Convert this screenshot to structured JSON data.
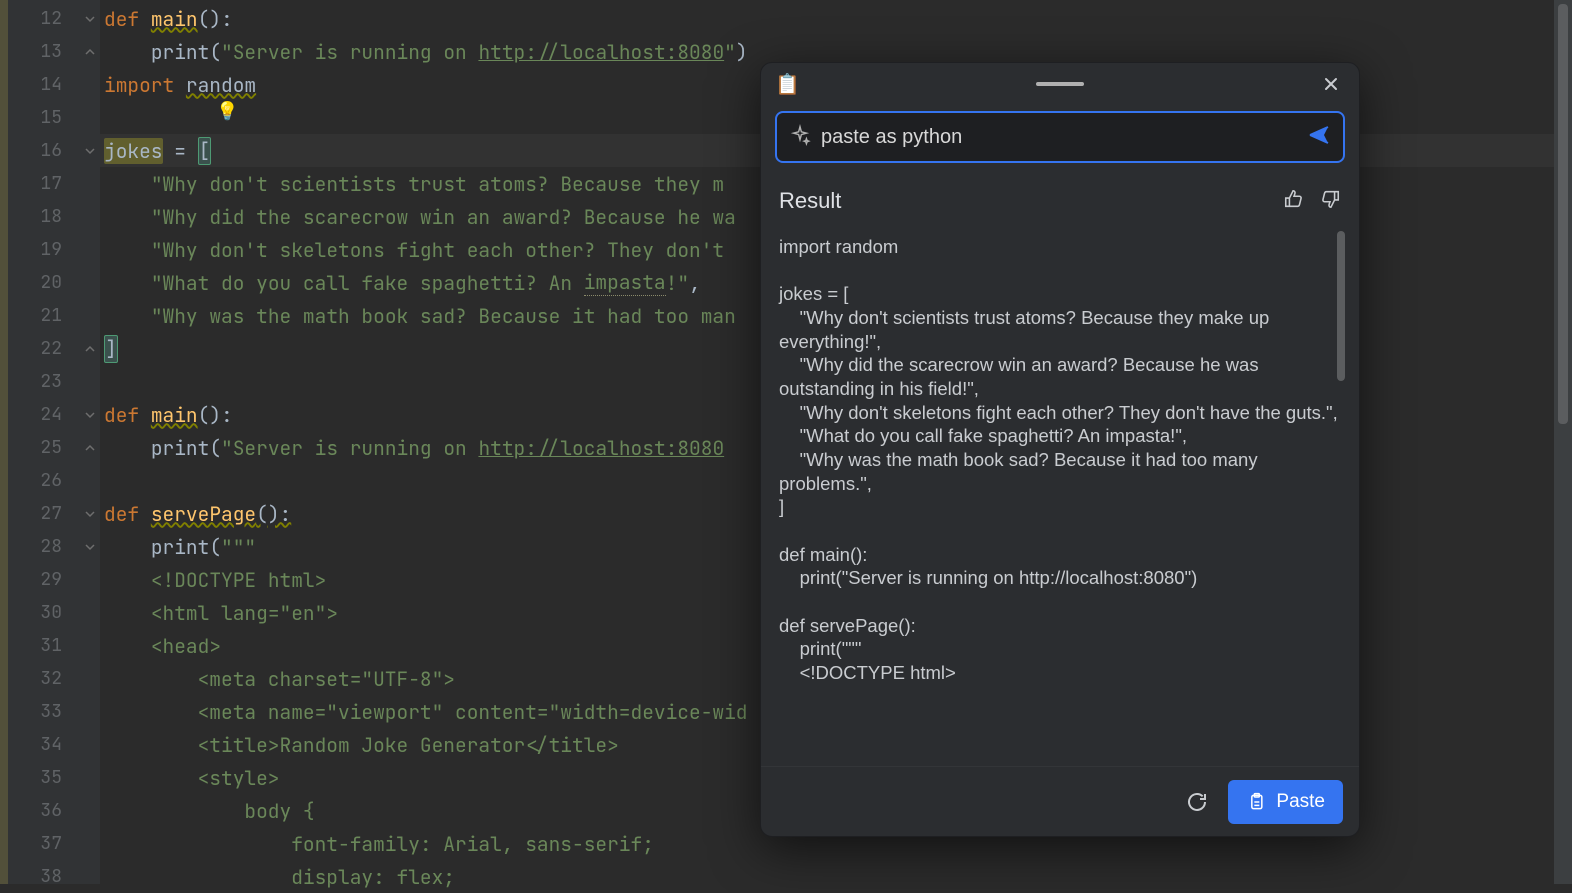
{
  "gutter": {
    "start": 12,
    "end": 38
  },
  "code": {
    "lines": [
      {
        "n": 12,
        "segments": [
          {
            "t": "def ",
            "c": "kw"
          },
          {
            "t": "main",
            "c": "fn warn-underline"
          },
          {
            "t": "():",
            "c": "plain"
          }
        ]
      },
      {
        "n": 13,
        "segments": [
          {
            "t": "    ",
            "c": "plain"
          },
          {
            "t": "print",
            "c": "plain"
          },
          {
            "t": "(",
            "c": "plain"
          },
          {
            "t": "\"Server is running on ",
            "c": "str"
          },
          {
            "t": "http://localhost:8080",
            "c": "url-in-str"
          },
          {
            "t": "\"",
            "c": "str"
          },
          {
            "t": ")",
            "c": "plain"
          }
        ]
      },
      {
        "n": 14,
        "segments": [
          {
            "t": "import ",
            "c": "kw"
          },
          {
            "t": "random",
            "c": "plain warn-underline"
          }
        ]
      },
      {
        "n": 15,
        "segments": []
      },
      {
        "n": 16,
        "segments": [
          {
            "t": "jokes",
            "c": "highlight-var"
          },
          {
            "t": " = ",
            "c": "plain"
          },
          {
            "t": "[",
            "c": "plain bracket-match"
          }
        ],
        "current": true
      },
      {
        "n": 17,
        "segments": [
          {
            "t": "    ",
            "c": "plain"
          },
          {
            "t": "\"Why don't scientists trust atoms? Because they m",
            "c": "str"
          }
        ]
      },
      {
        "n": 18,
        "segments": [
          {
            "t": "    ",
            "c": "plain"
          },
          {
            "t": "\"Why did the scarecrow win an award? Because he wa",
            "c": "str"
          }
        ]
      },
      {
        "n": 19,
        "segments": [
          {
            "t": "    ",
            "c": "plain"
          },
          {
            "t": "\"Why don't skeletons fight each other? They don't",
            "c": "str"
          }
        ]
      },
      {
        "n": 20,
        "segments": [
          {
            "t": "    ",
            "c": "plain"
          },
          {
            "t": "\"What do you call fake spaghetti? An ",
            "c": "str"
          },
          {
            "t": "impasta",
            "c": "str misspell"
          },
          {
            "t": "!\"",
            "c": "str"
          },
          {
            "t": ",",
            "c": "plain"
          }
        ]
      },
      {
        "n": 21,
        "segments": [
          {
            "t": "    ",
            "c": "plain"
          },
          {
            "t": "\"Why was the math book sad? Because it had too man",
            "c": "str"
          }
        ]
      },
      {
        "n": 22,
        "segments": [
          {
            "t": "]",
            "c": "plain bracket-match"
          }
        ]
      },
      {
        "n": 23,
        "segments": []
      },
      {
        "n": 24,
        "segments": [
          {
            "t": "def ",
            "c": "kw"
          },
          {
            "t": "main",
            "c": "fn warn-underline"
          },
          {
            "t": "():",
            "c": "plain"
          }
        ]
      },
      {
        "n": 25,
        "segments": [
          {
            "t": "    ",
            "c": "plain"
          },
          {
            "t": "print",
            "c": "plain"
          },
          {
            "t": "(",
            "c": "plain"
          },
          {
            "t": "\"Server is running on ",
            "c": "str"
          },
          {
            "t": "http://localhost:8080",
            "c": "url-in-str"
          }
        ]
      },
      {
        "n": 26,
        "segments": []
      },
      {
        "n": 27,
        "segments": [
          {
            "t": "def ",
            "c": "kw"
          },
          {
            "t": "servePage",
            "c": "fn warn-underline"
          },
          {
            "t": "():",
            "c": "plain warn-underline"
          }
        ]
      },
      {
        "n": 28,
        "segments": [
          {
            "t": "    ",
            "c": "plain"
          },
          {
            "t": "print",
            "c": "plain"
          },
          {
            "t": "(",
            "c": "plain"
          },
          {
            "t": "\"\"\"",
            "c": "str"
          }
        ]
      },
      {
        "n": 29,
        "segments": [
          {
            "t": "    ",
            "c": "plain"
          },
          {
            "t": "<!DOCTYPE html>",
            "c": "str"
          }
        ]
      },
      {
        "n": 30,
        "segments": [
          {
            "t": "    ",
            "c": "plain"
          },
          {
            "t": "<html lang=\"en\">",
            "c": "str"
          }
        ]
      },
      {
        "n": 31,
        "segments": [
          {
            "t": "    ",
            "c": "plain"
          },
          {
            "t": "<head>",
            "c": "str"
          }
        ]
      },
      {
        "n": 32,
        "segments": [
          {
            "t": "        ",
            "c": "plain"
          },
          {
            "t": "<meta charset=\"UTF-8\">",
            "c": "str"
          }
        ]
      },
      {
        "n": 33,
        "segments": [
          {
            "t": "        ",
            "c": "plain"
          },
          {
            "t": "<meta name=\"viewport\" content=\"width=device-wid",
            "c": "str"
          }
        ]
      },
      {
        "n": 34,
        "segments": [
          {
            "t": "        ",
            "c": "plain"
          },
          {
            "t": "<title>Random Joke Generator</title>",
            "c": "str"
          }
        ]
      },
      {
        "n": 35,
        "segments": [
          {
            "t": "        ",
            "c": "plain"
          },
          {
            "t": "<style>",
            "c": "str"
          }
        ]
      },
      {
        "n": 36,
        "segments": [
          {
            "t": "            ",
            "c": "plain"
          },
          {
            "t": "body {",
            "c": "str"
          }
        ]
      },
      {
        "n": 37,
        "segments": [
          {
            "t": "                ",
            "c": "plain"
          },
          {
            "t": "font-family: Arial, sans-serif;",
            "c": "str"
          }
        ]
      },
      {
        "n": 38,
        "segments": [
          {
            "t": "                ",
            "c": "plain"
          },
          {
            "t": "display: flex;",
            "c": "str"
          }
        ]
      }
    ]
  },
  "lightbulb": "💡",
  "panel": {
    "emoji": "📋",
    "input_value": "paste as python",
    "result_label": "Result",
    "result_text": "import random\n\njokes = [\n    \"Why don't scientists trust atoms? Because they make up everything!\",\n    \"Why did the scarecrow win an award? Because he was outstanding in his field!\",\n    \"Why don't skeletons fight each other? They don't have the guts.\",\n    \"What do you call fake spaghetti? An impasta!\",\n    \"Why was the math book sad? Because it had too many problems.\",\n]\n\ndef main():\n    print(\"Server is running on http://localhost:8080\")\n\ndef servePage():\n    print(\"\"\"\n    <!DOCTYPE html>",
    "paste_label": "Paste"
  }
}
